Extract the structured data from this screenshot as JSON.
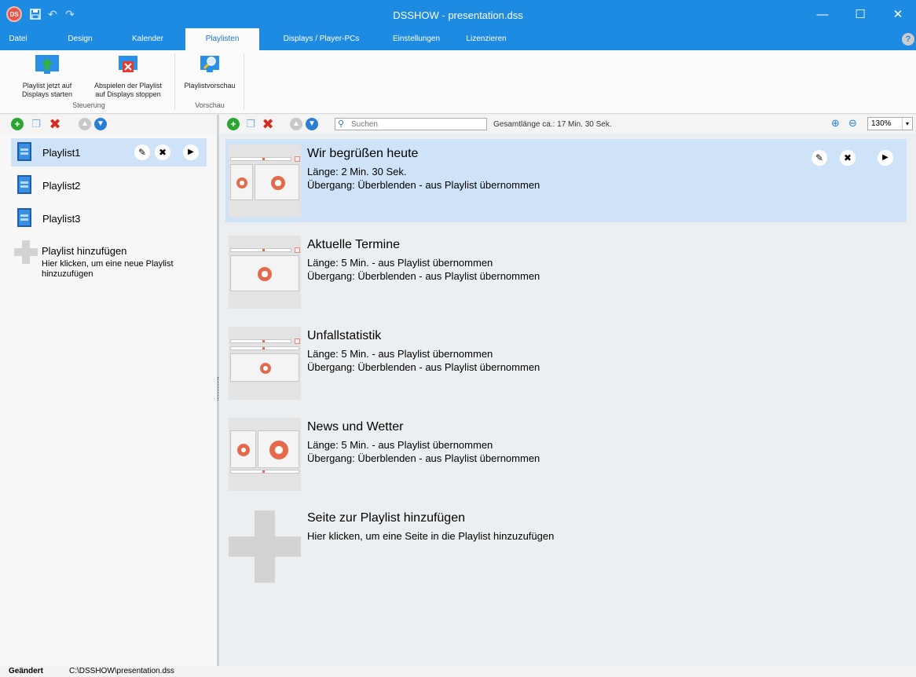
{
  "window": {
    "title": "DSSHOW - presentation.dss",
    "app_icon_text": "DS",
    "minimize": "—",
    "maximize": "☐",
    "close": "✕"
  },
  "quick_access": {
    "save_icon": "save-icon",
    "undo_icon": "undo-icon",
    "redo_icon": "redo-icon"
  },
  "tabs": [
    {
      "label": "Datei",
      "active": false
    },
    {
      "label": "Design",
      "active": false
    },
    {
      "label": "Kalender",
      "active": false
    },
    {
      "label": "Playlisten",
      "active": true
    },
    {
      "label": "Displays / Player-PCs",
      "active": false
    },
    {
      "label": "Einstellungen",
      "active": false
    },
    {
      "label": "Lizenzieren",
      "active": false
    }
  ],
  "help_label": "?",
  "ribbon": {
    "groups": [
      {
        "label": "Steuerung",
        "buttons": [
          {
            "line1": "Playlist jetzt auf",
            "line2": "Displays starten"
          },
          {
            "line1": "Abspielen der Playlist",
            "line2": "auf Displays stoppen"
          }
        ]
      },
      {
        "label": "Vorschau",
        "buttons": [
          {
            "line1": "Playlistvorschau",
            "line2": ""
          }
        ]
      }
    ]
  },
  "left_toolbar": {
    "icons": [
      "add-icon",
      "copy-icon",
      "delete-icon",
      "move-up-icon",
      "move-down-icon"
    ]
  },
  "main_toolbar": {
    "search_placeholder": "Suchen",
    "total_length": "Gesamtlänge ca.: 17 Min. 30 Sek.",
    "zoom": "130%"
  },
  "playlists": [
    {
      "name": "Playlist1",
      "selected": true
    },
    {
      "name": "Playlist2",
      "selected": false
    },
    {
      "name": "Playlist3",
      "selected": false
    }
  ],
  "add_playlist": {
    "title": "Playlist hinzufügen",
    "description": "Hier klicken, um eine neue Playlist hinzuzufügen"
  },
  "pages": [
    {
      "title": "Wir begrüßen heute",
      "length": "Länge: 2 Min. 30 Sek.",
      "transition": "Übergang: Überblenden - aus Playlist übernommen",
      "selected": true
    },
    {
      "title": "Aktuelle Termine",
      "length": "Länge: 5 Min. - aus Playlist übernommen",
      "transition": "Übergang: Überblenden - aus Playlist übernommen",
      "selected": false
    },
    {
      "title": "Unfallstatistik",
      "length": "Länge: 5 Min. - aus Playlist übernommen",
      "transition": "Übergang: Überblenden - aus Playlist übernommen",
      "selected": false
    },
    {
      "title": "News und Wetter",
      "length": "Länge: 5 Min. - aus Playlist übernommen",
      "transition": "Übergang: Überblenden - aus Playlist übernommen",
      "selected": false
    }
  ],
  "add_page": {
    "title": "Seite zur Playlist hinzufügen",
    "description": "Hier klicken, um eine Seite in die Playlist hinzuzufügen"
  },
  "status": {
    "state": "Geändert",
    "path": "C:\\DSSHOW\\presentation.dss"
  },
  "colors": {
    "accent": "#1e8be3",
    "selection": "#cfe3f8",
    "delete": "#d52b1e",
    "add": "#2aa531"
  }
}
